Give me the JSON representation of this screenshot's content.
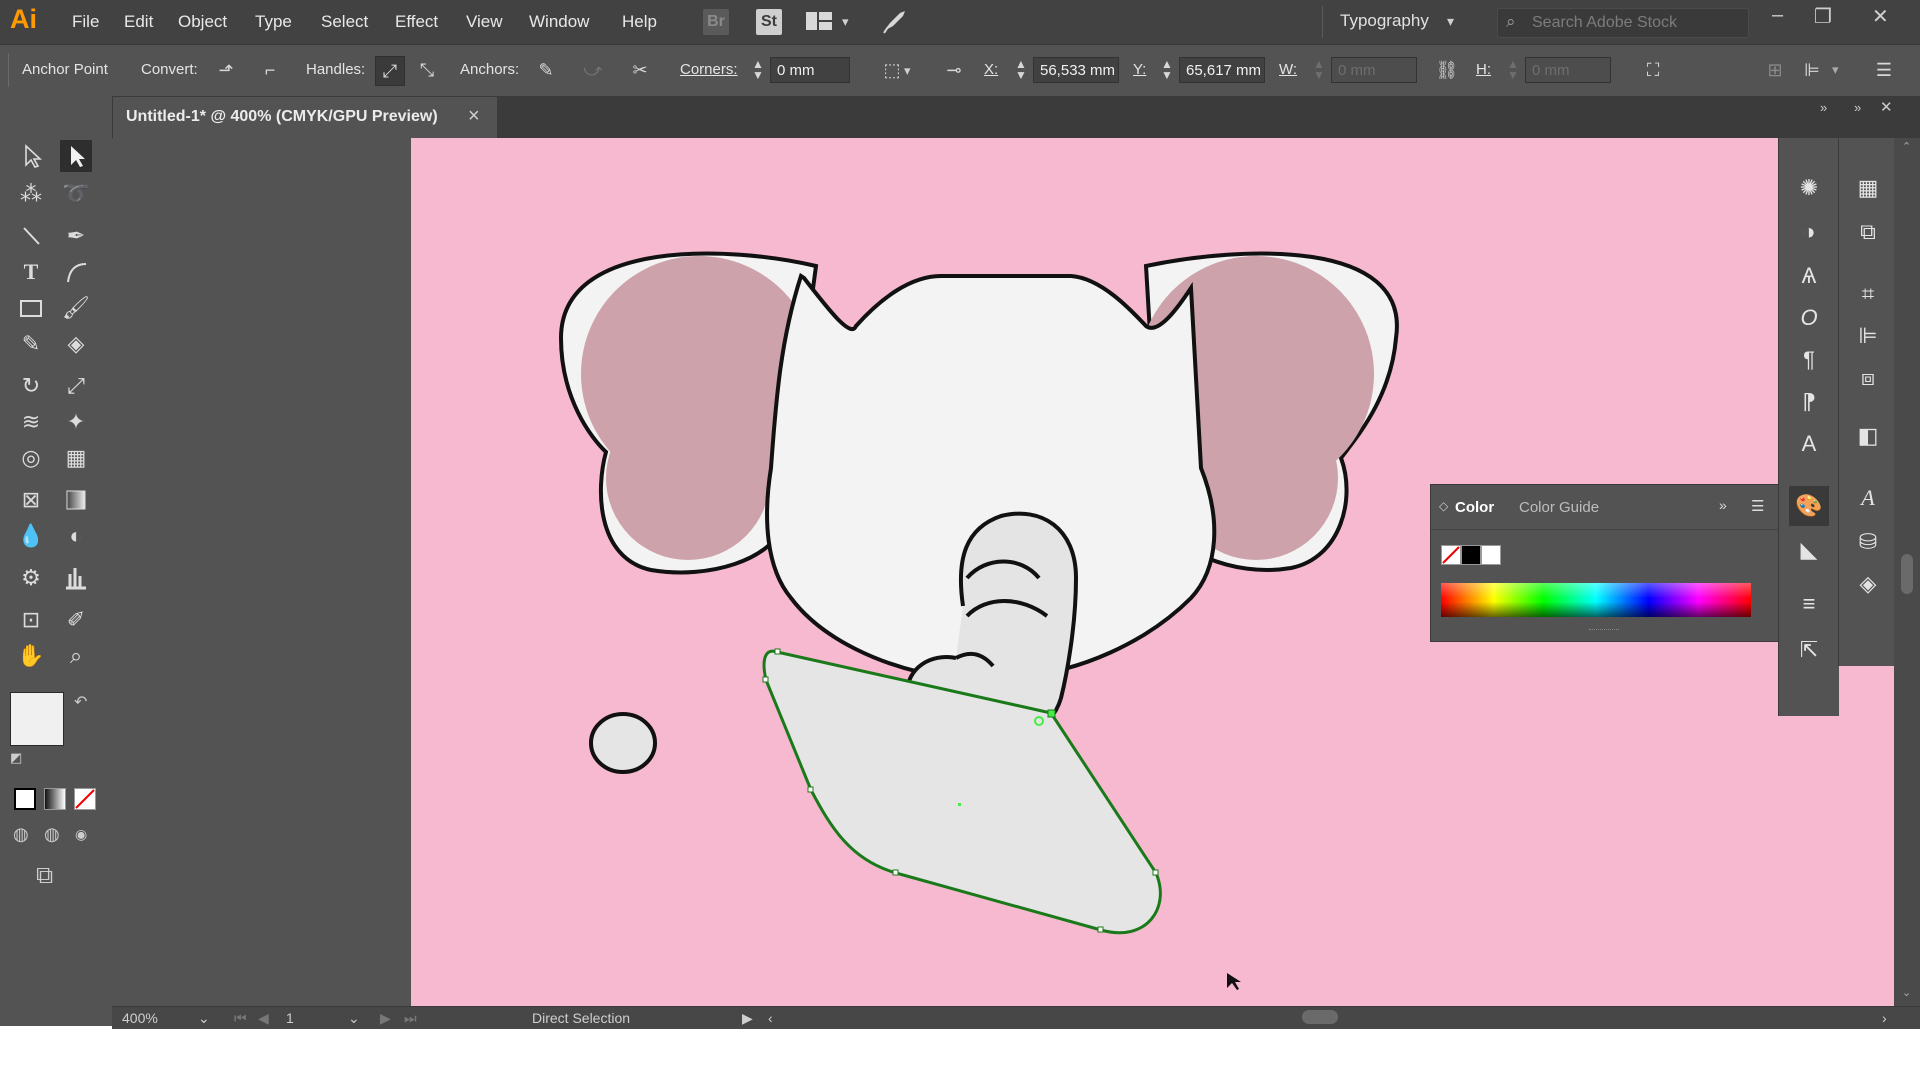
{
  "app": {
    "logo": "Ai"
  },
  "menu": [
    "File",
    "Edit",
    "Object",
    "Type",
    "Select",
    "Effect",
    "View",
    "Window",
    "Help"
  ],
  "app_buttons": {
    "bridge": "Br",
    "stock": "St"
  },
  "workspace": {
    "label": "Typography"
  },
  "search": {
    "placeholder": "Search Adobe Stock"
  },
  "control_bar": {
    "tool_label": "Anchor Point",
    "convert_label": "Convert:",
    "handles_label": "Handles:",
    "anchors_label": "Anchors:",
    "corners_label": "Corners:",
    "corners_value": "0 mm",
    "x_label": "X:",
    "x_value": "56,533 mm",
    "y_label": "Y:",
    "y_value": "65,617 mm",
    "w_label": "W:",
    "w_value": "0 mm",
    "h_label": "H:",
    "h_value": "0 mm"
  },
  "document": {
    "tab_title": "Untitled-1* @ 400% (CMYK/GPU Preview)",
    "close": "×"
  },
  "color_panel": {
    "tab_color": "Color",
    "tab_guide": "Color Guide"
  },
  "status_bar": {
    "zoom": "400%",
    "artboard": "1",
    "tool": "Direct Selection"
  },
  "colors": {
    "artboard": "#f6b9cf",
    "ui_dark": "#535353",
    "ear_inner": "#cda2ab",
    "face": "#f3f3f3",
    "shape_fill": "#e5e5e5",
    "selection": "#1a7a1a",
    "anchor_selected": "#44ee44"
  }
}
